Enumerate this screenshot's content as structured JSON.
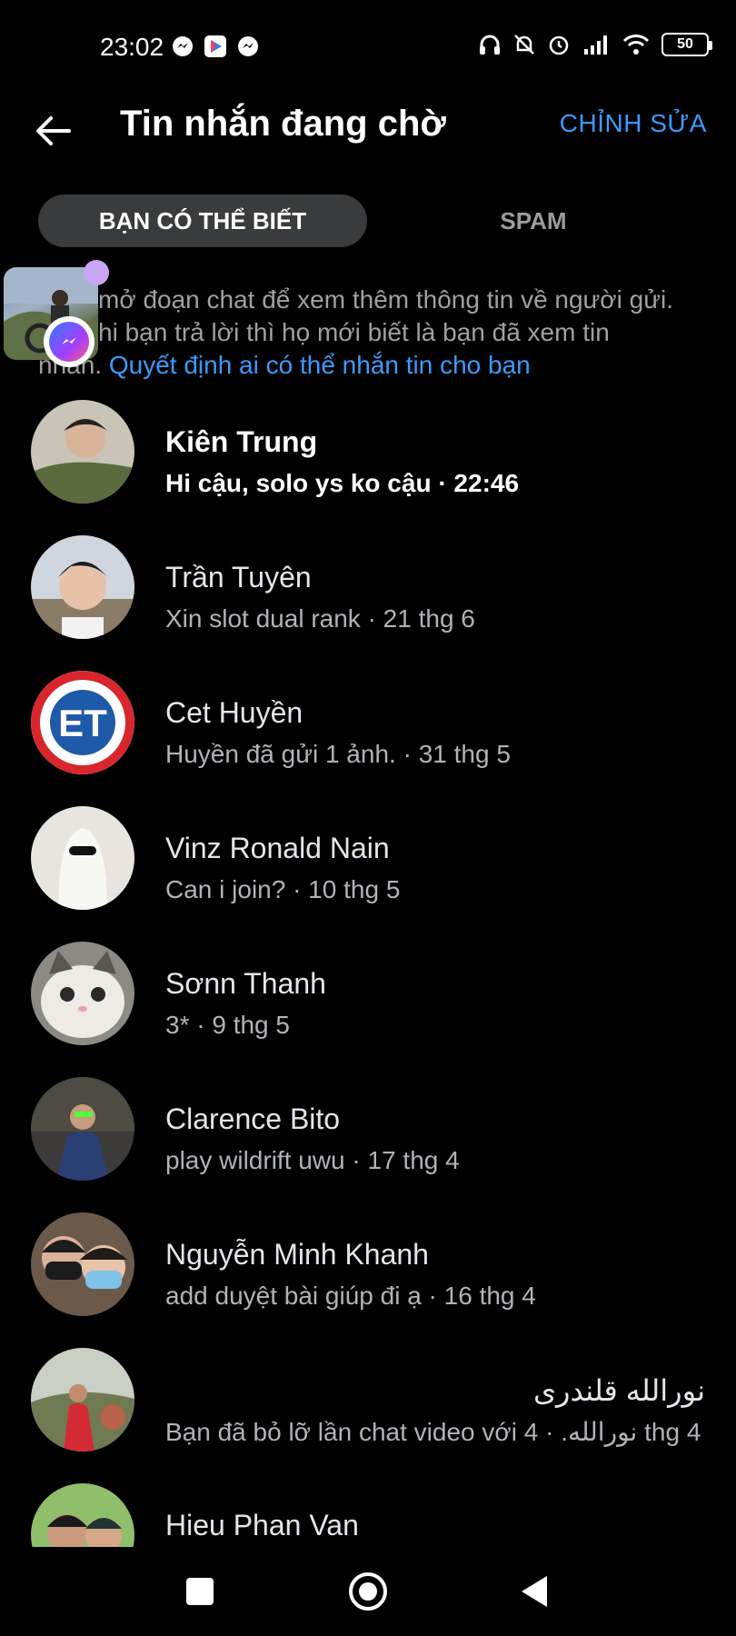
{
  "status_bar": {
    "time": "23:02",
    "battery": "50",
    "left_icons": [
      "messenger-icon",
      "play-store-icon",
      "messenger-icon"
    ],
    "right_icons": [
      "headphones-icon",
      "bell-off-icon",
      "alarm-icon",
      "signal-icon",
      "wifi-icon",
      "battery-icon"
    ]
  },
  "header": {
    "title": "Tin nhắn đang chờ",
    "edit_label": "CHỈNH SỬA",
    "back_icon": "arrow-left-icon"
  },
  "tabs": [
    {
      "label": "BẠN CÓ THỂ BIẾT",
      "active": true
    },
    {
      "label": "SPAM",
      "active": false
    }
  ],
  "info": {
    "text_line1": "mở đoạn chat để xem thêm thông tin về người gửi.",
    "text_line2": "hi bạn trả lời thì họ mới biết là bạn đã xem tin",
    "text_line3_prefix": "nhắn.",
    "link": "Quyết định ai có thể nhắn tin cho bạn"
  },
  "chats": [
    {
      "name": "Kiên Trung",
      "preview": "Hi cậu, solo ys ko cậu · 22:46",
      "unread": true
    },
    {
      "name": "Trần Tuyên",
      "preview": "Xin slot dual rank · 21 thg 6",
      "unread": false
    },
    {
      "name": "Cet Huyền",
      "preview": "Huyền đã gửi 1 ảnh. · 31 thg 5",
      "unread": false
    },
    {
      "name": "Vinz Ronald Nain",
      "preview": "Can i join? · 10 thg 5",
      "unread": false
    },
    {
      "name": "Sơnn Thanh",
      "preview": "3* · 9 thg 5",
      "unread": false
    },
    {
      "name": "Clarence Bito",
      "preview": "play wildrift uwu · 17 thg 4",
      "unread": false
    },
    {
      "name": "Nguyễn Minh Khanh",
      "preview": "add duyệt bài giúp đi ạ · 16 thg 4",
      "unread": false
    },
    {
      "name": "نورالله قلندری",
      "preview": "Bạn đã bỏ lỡ lần chat video với نورالله. · 4 thg 4",
      "unread": false
    },
    {
      "name": "Hieu Phan Van",
      "preview": "",
      "unread": false
    }
  ],
  "colors": {
    "accent": "#3b9bff",
    "background": "#000000",
    "tab_active_bg": "#3a3b3c",
    "secondary_text": "#b0b3b8"
  }
}
